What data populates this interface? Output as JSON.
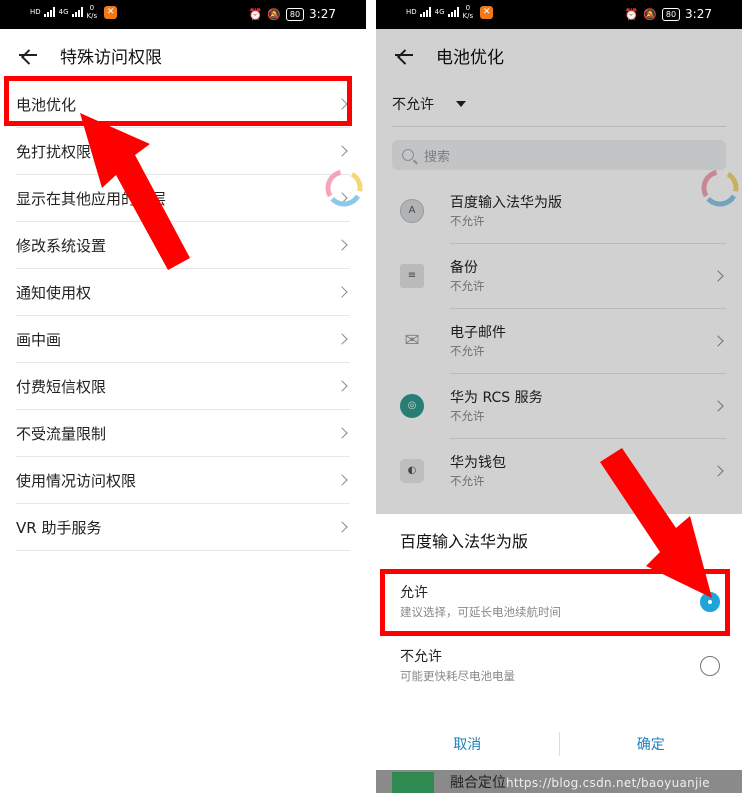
{
  "status_bar": {
    "hd_label": "HD",
    "network": "4G",
    "speed_value": "0",
    "speed_unit": "K/s",
    "battery": "80",
    "time": "3:27"
  },
  "left_screen": {
    "title": "特殊访问权限",
    "items": [
      {
        "label": "电池优化"
      },
      {
        "label": "免打扰权限"
      },
      {
        "label": "显示在其他应用的上层"
      },
      {
        "label": "修改系统设置"
      },
      {
        "label": "通知使用权"
      },
      {
        "label": "画中画"
      },
      {
        "label": "付费短信权限"
      },
      {
        "label": "不受流量限制"
      },
      {
        "label": "使用情况访问权限"
      },
      {
        "label": "VR 助手服务"
      }
    ]
  },
  "right_screen": {
    "title": "电池优化",
    "filter_value": "不允许",
    "search_placeholder": "搜索",
    "apps": [
      {
        "name": "百度输入法华为版",
        "status": "不允许",
        "icon": "keyboard-app-icon"
      },
      {
        "name": "备份",
        "status": "不允许",
        "icon": "backup-app-icon"
      },
      {
        "name": "电子邮件",
        "status": "不允许",
        "icon": "email-app-icon"
      },
      {
        "name": "华为 RCS 服务",
        "status": "不允许",
        "icon": "rcs-app-icon"
      },
      {
        "name": "华为钱包",
        "status": "不允许",
        "icon": "wallet-app-icon"
      }
    ],
    "dialog": {
      "title": "百度输入法华为版",
      "options": [
        {
          "label": "允许",
          "desc": "建议选择，可延长电池续航时间",
          "selected": true
        },
        {
          "label": "不允许",
          "desc": "可能更快耗尽电池电量",
          "selected": false
        }
      ],
      "cancel": "取消",
      "confirm": "确定"
    },
    "peek_item": "融合定位",
    "watermark": "https://blog.csdn.net/baoyuanjie"
  },
  "colors": {
    "highlight": "#ff0000",
    "accent": "#1ea4d8",
    "action": "#1d7fb8"
  }
}
